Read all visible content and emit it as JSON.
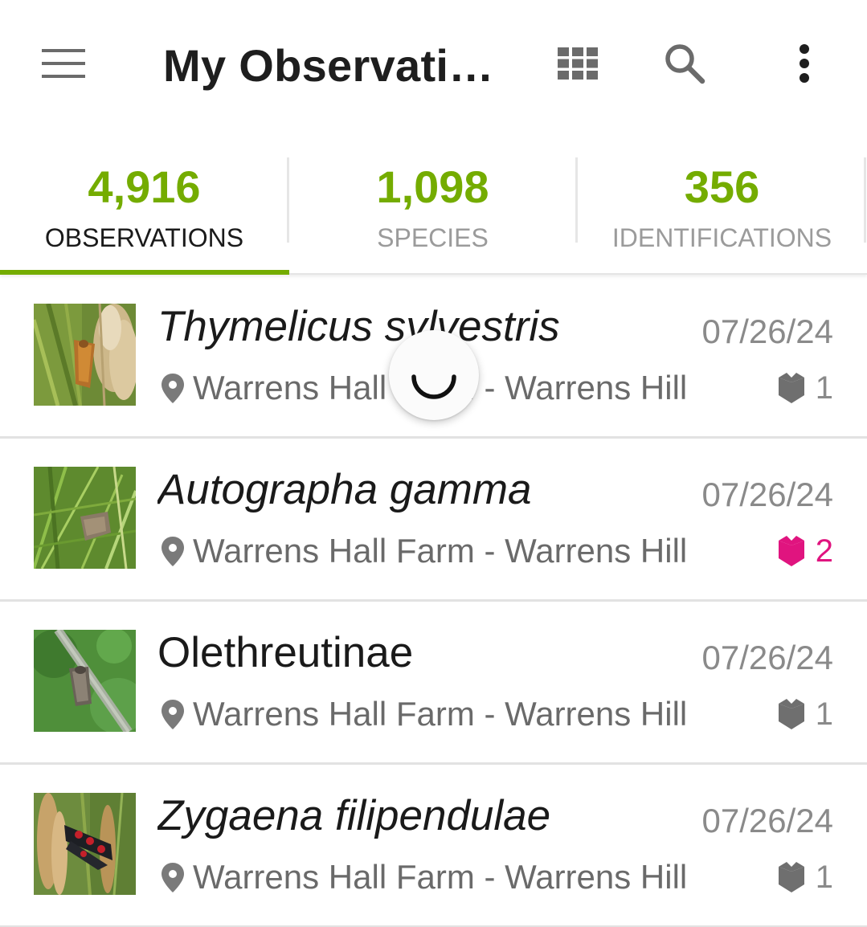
{
  "appbar": {
    "title": "My Observatio...",
    "icons": {
      "menu": "menu-icon",
      "grid": "grid-view-icon",
      "search": "search-icon",
      "more": "more-vert-icon"
    }
  },
  "stats": [
    {
      "count": "4,916",
      "label": "OBSERVATIONS",
      "active": true
    },
    {
      "count": "1,098",
      "label": "SPECIES",
      "active": false
    },
    {
      "count": "356",
      "label": "IDENTIFICATIONS",
      "active": false
    }
  ],
  "colors": {
    "accent": "#74ac00",
    "highlight": "#e0147f",
    "muted": "#8a8a8a"
  },
  "observations": [
    {
      "name": "Thymelicus sylvestris",
      "italic": true,
      "date": "07/26/24",
      "location": "Warrens Hall Farm - Warrens Hill",
      "identifications": "1",
      "highlight": false
    },
    {
      "name": "Autographa gamma",
      "italic": true,
      "date": "07/26/24",
      "location": "Warrens Hall Farm - Warrens Hill",
      "identifications": "2",
      "highlight": true
    },
    {
      "name": "Olethreutinae",
      "italic": false,
      "date": "07/26/24",
      "location": "Warrens Hall Farm - Warrens Hill",
      "identifications": "1",
      "highlight": false
    },
    {
      "name": "Zygaena filipendulae",
      "italic": true,
      "date": "07/26/24",
      "location": "Warrens Hall Farm - Warrens Hill",
      "identifications": "1",
      "highlight": false
    }
  ],
  "loading": true
}
